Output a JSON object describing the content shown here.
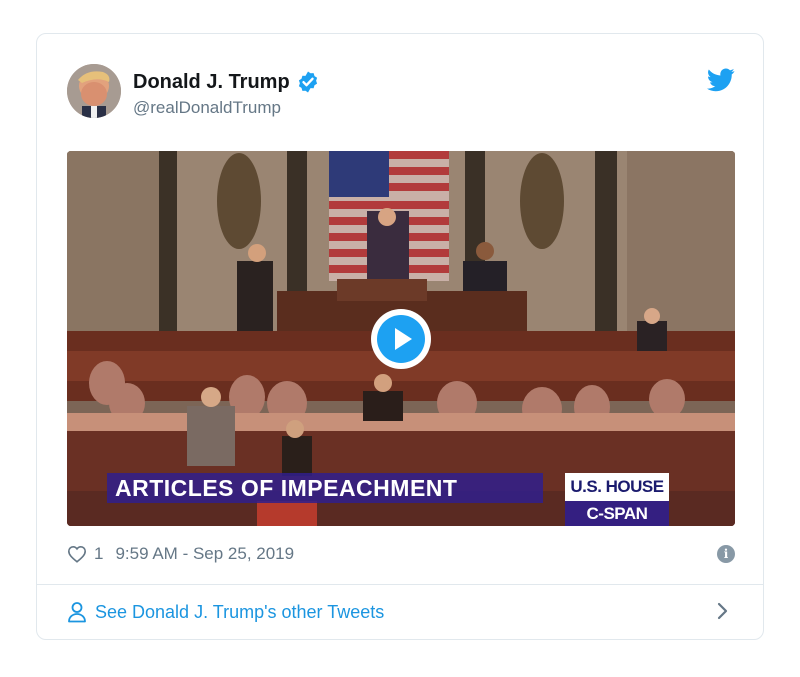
{
  "author": {
    "display_name": "Donald J. Trump",
    "handle": "@realDonaldTrump",
    "verified": true
  },
  "media": {
    "type": "video",
    "lower_third": "ARTICLES  OF  IMPEACHMENT",
    "badge_top": "U.S. HOUSE",
    "badge_bottom": "C-SPAN"
  },
  "tweet_meta": {
    "like_count": "1",
    "timestamp": "9:59 AM - Sep 25, 2019"
  },
  "footer": {
    "link_text": "See Donald J. Trump's other Tweets"
  },
  "colors": {
    "brand_blue": "#1da1f2",
    "link_blue": "#1b95e0",
    "muted_text": "#657786",
    "border": "#e1e8ed",
    "cspan_purple": "#301e8c"
  },
  "icons": {
    "verified": "verified-badge-icon",
    "brand": "twitter-bird-icon",
    "play": "play-icon",
    "like": "heart-icon",
    "info": "info-icon",
    "profile": "person-icon",
    "chevron": "chevron-right-icon"
  }
}
